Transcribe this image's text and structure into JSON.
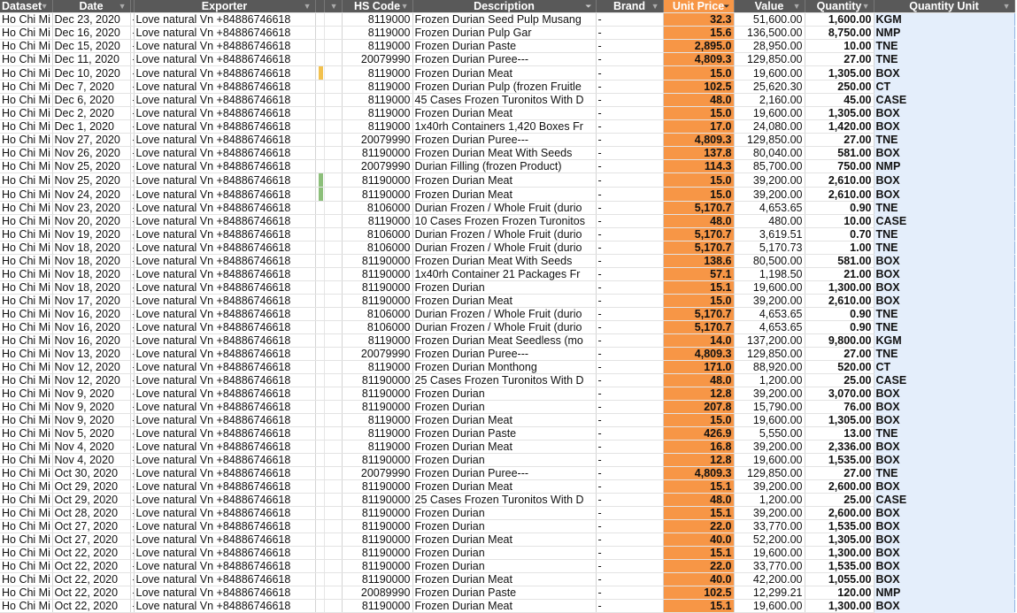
{
  "columns": {
    "dataset": "Dataset",
    "date": "Date",
    "exporter": "Exporter",
    "hs_code": "HS Code",
    "description": "Description",
    "brand": "Brand",
    "unit_price": "Unit Price",
    "value": "Value",
    "quantity": "Quantity",
    "quantity_unit": "Quantity Unit"
  },
  "colors": {
    "header_bg": "#595959",
    "unit_price_bg": "#f79646",
    "quantity_unit_bg": "#e4eefb",
    "marker_yellow": "#f2c14e",
    "marker_green": "#8cbf7a"
  },
  "common": {
    "dataset": "Ho Chi Mi",
    "sep": "-",
    "exporter": "Love natural Vn +84886746618",
    "brand": "-"
  },
  "rows": [
    [
      "Dec 23, 2020",
      "8119000",
      "Frozen Durian Seed Pulp Musang",
      "32.3",
      "51,600.00",
      "1,600.00",
      "KGM",
      ""
    ],
    [
      "Dec 16, 2020",
      "8119000",
      "Frozen Durian Pulp Gar",
      "15.6",
      "136,500.00",
      "8,750.00",
      "NMP",
      ""
    ],
    [
      "Dec 15, 2020",
      "8119000",
      "Frozen Durian Paste",
      "2,895.0",
      "28,950.00",
      "10.00",
      "TNE",
      ""
    ],
    [
      "Dec 11, 2020",
      "20079990",
      "Frozen Durian Puree---",
      "4,809.3",
      "129,850.00",
      "27.00",
      "TNE",
      ""
    ],
    [
      "Dec 10, 2020",
      "8119000",
      "Frozen Durian Meat",
      "15.0",
      "19,600.00",
      "1,305.00",
      "BOX",
      "yellow"
    ],
    [
      "Dec 7, 2020",
      "8119000",
      "Frozen Durian Pulp (frozen Fruitle",
      "102.5",
      "25,620.30",
      "250.00",
      "CT",
      ""
    ],
    [
      "Dec 6, 2020",
      "8119000",
      "45 Cases Frozen Turonitos With D",
      "48.0",
      "2,160.00",
      "45.00",
      "CASE",
      ""
    ],
    [
      "Dec 2, 2020",
      "8119000",
      "Frozen Durian Meat",
      "15.0",
      "19,600.00",
      "1,305.00",
      "BOX",
      ""
    ],
    [
      "Dec 1, 2020",
      "8119000",
      "1x40rh Containers 1,420 Boxes Fr",
      "17.0",
      "24,080.00",
      "1,420.00",
      "BOX",
      ""
    ],
    [
      "Nov 27, 2020",
      "20079990",
      "Frozen Durian Puree---",
      "4,809.3",
      "129,850.00",
      "27.00",
      "TNE",
      ""
    ],
    [
      "Nov 26, 2020",
      "81190000",
      "Frozen Durian Meat With Seeds",
      "137.8",
      "80,040.00",
      "581.00",
      "BOX",
      ""
    ],
    [
      "Nov 25, 2020",
      "20079990",
      "Durian Filling (frozen Product)",
      "114.3",
      "85,700.00",
      "750.00",
      "NMP",
      ""
    ],
    [
      "Nov 25, 2020",
      "81190000",
      "Frozen Durian Meat",
      "15.0",
      "39,200.00",
      "2,610.00",
      "BOX",
      "green"
    ],
    [
      "Nov 24, 2020",
      "81190000",
      "Frozen Durian Meat",
      "15.0",
      "39,200.00",
      "2,610.00",
      "BOX",
      "green"
    ],
    [
      "Nov 23, 2020",
      "8106000",
      "Durian Frozen / Whole Fruit (durio",
      "5,170.7",
      "4,653.65",
      "0.90",
      "TNE",
      ""
    ],
    [
      "Nov 20, 2020",
      "8119000",
      "10 Cases Frozen Frozen Turonitos",
      "48.0",
      "480.00",
      "10.00",
      "CASE",
      ""
    ],
    [
      "Nov 19, 2020",
      "8106000",
      "Durian Frozen / Whole Fruit (durio",
      "5,170.7",
      "3,619.51",
      "0.70",
      "TNE",
      ""
    ],
    [
      "Nov 18, 2020",
      "8106000",
      "Durian Frozen / Whole Fruit (durio",
      "5,170.7",
      "5,170.73",
      "1.00",
      "TNE",
      ""
    ],
    [
      "Nov 18, 2020",
      "81190000",
      "Frozen Durian Meat With Seeds",
      "138.6",
      "80,500.00",
      "581.00",
      "BOX",
      ""
    ],
    [
      "Nov 18, 2020",
      "81190000",
      "1x40rh Container 21 Packages  Fr",
      "57.1",
      "1,198.50",
      "21.00",
      "BOX",
      ""
    ],
    [
      "Nov 18, 2020",
      "81190000",
      "Frozen Durian",
      "15.1",
      "19,600.00",
      "1,300.00",
      "BOX",
      ""
    ],
    [
      "Nov 17, 2020",
      "81190000",
      "Frozen Durian Meat",
      "15.0",
      "39,200.00",
      "2,610.00",
      "BOX",
      ""
    ],
    [
      "Nov 16, 2020",
      "8106000",
      "Durian Frozen / Whole Fruit (durio",
      "5,170.7",
      "4,653.65",
      "0.90",
      "TNE",
      ""
    ],
    [
      "Nov 16, 2020",
      "8106000",
      "Durian Frozen / Whole Fruit (durio",
      "5,170.7",
      "4,653.65",
      "0.90",
      "TNE",
      ""
    ],
    [
      "Nov 16, 2020",
      "8119000",
      "Frozen Durian Meat Seedless (mo",
      "14.0",
      "137,200.00",
      "9,800.00",
      "KGM",
      ""
    ],
    [
      "Nov 13, 2020",
      "20079990",
      "Frozen Durian Puree---",
      "4,809.3",
      "129,850.00",
      "27.00",
      "TNE",
      ""
    ],
    [
      "Nov 12, 2020",
      "8119000",
      "Frozen Durian Monthong",
      "171.0",
      "88,920.00",
      "520.00",
      "CT",
      ""
    ],
    [
      "Nov 12, 2020",
      "81190000",
      "25 Cases Frozen Turonitos With D",
      "48.0",
      "1,200.00",
      "25.00",
      "CASE",
      ""
    ],
    [
      "Nov 9, 2020",
      "81190000",
      "Frozen Durian",
      "12.8",
      "39,200.00",
      "3,070.00",
      "BOX",
      ""
    ],
    [
      "Nov 9, 2020",
      "81190000",
      "Frozen Durian",
      "207.8",
      "15,790.00",
      "76.00",
      "BOX",
      ""
    ],
    [
      "Nov 9, 2020",
      "8119000",
      "Frozen Durian Meat",
      "15.0",
      "19,600.00",
      "1,305.00",
      "BOX",
      ""
    ],
    [
      "Nov 5, 2020",
      "8119000",
      "Frozen Durian Paste",
      "426.9",
      "5,550.00",
      "13.00",
      "TNE",
      ""
    ],
    [
      "Nov 4, 2020",
      "8119000",
      "Frozen Durian Meat",
      "16.8",
      "39,200.00",
      "2,336.00",
      "BOX",
      ""
    ],
    [
      "Nov 4, 2020",
      "81190000",
      "Frozen Durian",
      "12.8",
      "19,600.00",
      "1,535.00",
      "BOX",
      ""
    ],
    [
      "Oct 30, 2020",
      "20079990",
      "Frozen Durian Puree---",
      "4,809.3",
      "129,850.00",
      "27.00",
      "TNE",
      ""
    ],
    [
      "Oct 29, 2020",
      "81190000",
      "Frozen Durian Meat",
      "15.1",
      "39,200.00",
      "2,600.00",
      "BOX",
      ""
    ],
    [
      "Oct 29, 2020",
      "81190000",
      "25 Cases Frozen Turonitos With D",
      "48.0",
      "1,200.00",
      "25.00",
      "CASE",
      ""
    ],
    [
      "Oct 28, 2020",
      "81190000",
      "Frozen Durian",
      "15.1",
      "39,200.00",
      "2,600.00",
      "BOX",
      ""
    ],
    [
      "Oct 27, 2020",
      "81190000",
      "Frozen Durian",
      "22.0",
      "33,770.00",
      "1,535.00",
      "BOX",
      ""
    ],
    [
      "Oct 27, 2020",
      "81190000",
      "Frozen Durian Meat",
      "40.0",
      "52,200.00",
      "1,305.00",
      "BOX",
      ""
    ],
    [
      "Oct 22, 2020",
      "81190000",
      "Frozen Durian",
      "15.1",
      "19,600.00",
      "1,300.00",
      "BOX",
      ""
    ],
    [
      "Oct 22, 2020",
      "81190000",
      "Frozen Durian",
      "22.0",
      "33,770.00",
      "1,535.00",
      "BOX",
      ""
    ],
    [
      "Oct 22, 2020",
      "81190000",
      "Frozen Durian Meat",
      "40.0",
      "42,200.00",
      "1,055.00",
      "BOX",
      ""
    ],
    [
      "Oct 22, 2020",
      "20089990",
      "Frozen Durian Paste",
      "102.5",
      "12,299.21",
      "120.00",
      "NMP",
      ""
    ],
    [
      "Oct 22, 2020",
      "81190000",
      "Frozen Durian Meat",
      "15.1",
      "19,600.00",
      "1,300.00",
      "BOX",
      ""
    ]
  ]
}
